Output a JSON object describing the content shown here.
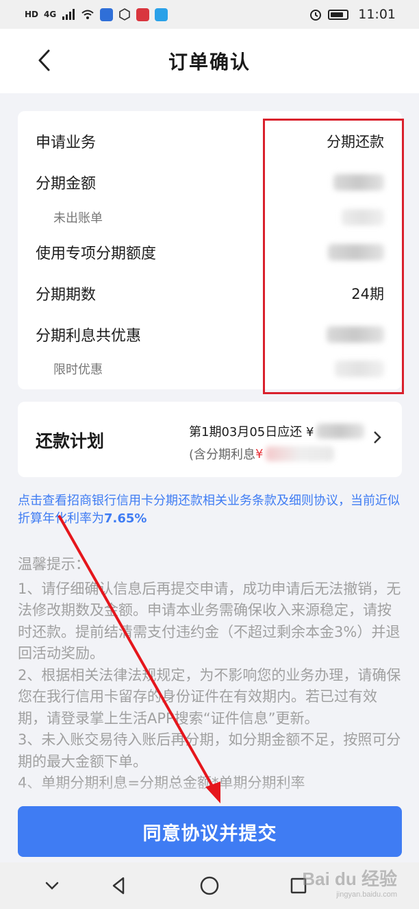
{
  "status_bar": {
    "network_tag": "HD",
    "signal_tag": "4G",
    "time": "11:01"
  },
  "header": {
    "title": "订单确认"
  },
  "details": {
    "rows": [
      {
        "label": "申请业务",
        "value": "分期还款"
      },
      {
        "label": "分期金额",
        "value": ""
      },
      {
        "label": "未出账单",
        "value": ""
      },
      {
        "label": "使用专项分期额度",
        "value": ""
      },
      {
        "label": "分期期数",
        "value": "24期"
      },
      {
        "label": "分期利息共优惠",
        "value": ""
      },
      {
        "label": "限时优惠",
        "value": ""
      }
    ]
  },
  "plan": {
    "title": "还款计划",
    "line1_prefix": "第1期03月05日应还 ¥",
    "line2_prefix": "(含分期利息 ",
    "line2_currency": "¥"
  },
  "agreement": {
    "text": "点击查看招商银行信用卡分期还款相关业务条款及细则协议，当前近似折算年化利率为",
    "rate": "7.65%"
  },
  "tips": {
    "title": "温馨提示：",
    "items": [
      "1、请仔细确认信息后再提交申请，成功申请后无法撤销，无法修改期数及金额。申请本业务需确保收入来源稳定，请按时还款。提前结清需支付违约金（不超过剩余本金3%）并退回活动奖励。",
      "2、根据相关法律法规规定，为不影响您的业务办理，请确保您在我行信用卡留存的身份证件在有效期内。若已过有效期，请登录掌上生活APP搜索“证件信息”更新。",
      "3、未入账交易待入账后再分期，如分期金额不足，按照可分期的最大金额下单。",
      "4、单期分期利息=分期总金额*单期分期利率"
    ]
  },
  "submit": {
    "label": "同意协议并提交"
  },
  "watermark": {
    "main": "Bai du 经验",
    "sub": "jingyan.baidu.com"
  },
  "colors": {
    "accent": "#3f7cf3",
    "highlight_red": "#d9202c"
  }
}
